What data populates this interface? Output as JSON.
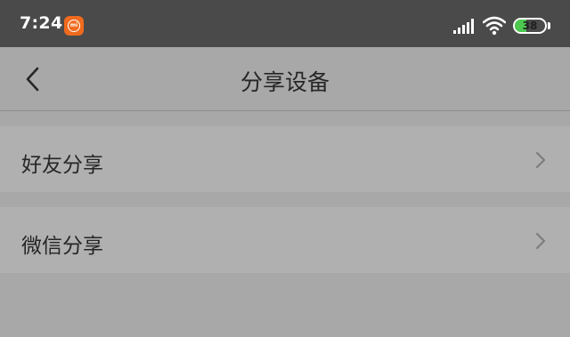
{
  "status_bar": {
    "time": "7:24",
    "app_badge_icon": "mi-home-icon",
    "signal_icon": "cellular-signal-icon",
    "wifi_icon": "wifi-icon",
    "battery_level": "38",
    "battery_color": "#4cc94e"
  },
  "header": {
    "back_icon": "chevron-left-icon",
    "title": "分享设备"
  },
  "menu": {
    "items": [
      {
        "label": "好友分享",
        "icon": "chevron-right-icon"
      },
      {
        "label": "微信分享",
        "icon": "chevron-right-icon"
      }
    ]
  },
  "colors": {
    "status_bar_bg": "#4a4a4a",
    "page_bg": "#a9a8a9",
    "row_bg": "#b1b0b1",
    "text": "#262626",
    "badge": "#f06b1e"
  }
}
